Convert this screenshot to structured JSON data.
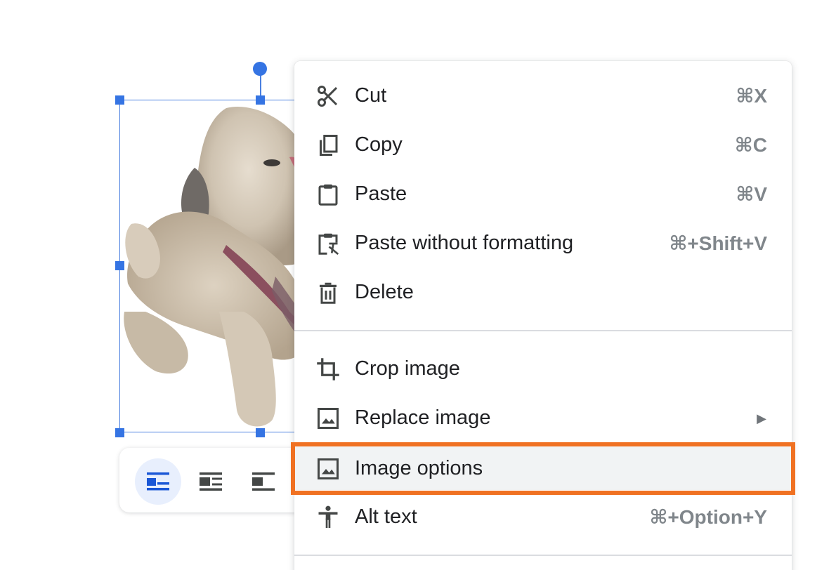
{
  "menu": {
    "items": [
      {
        "label": "Cut",
        "shortcut": "⌘X",
        "icon": "scissors-icon"
      },
      {
        "label": "Copy",
        "shortcut": "⌘C",
        "icon": "copy-icon"
      },
      {
        "label": "Paste",
        "shortcut": "⌘V",
        "icon": "clipboard-icon"
      },
      {
        "label": "Paste without formatting",
        "shortcut": "⌘+Shift+V",
        "icon": "clipboard-clear-format-icon"
      },
      {
        "label": "Delete",
        "shortcut": "",
        "icon": "trash-icon"
      },
      {
        "label": "Crop image",
        "shortcut": "",
        "icon": "crop-icon"
      },
      {
        "label": "Replace image",
        "shortcut": "",
        "icon": "image-icon",
        "submenu_arrow": "▶"
      },
      {
        "label": "Image options",
        "shortcut": "",
        "icon": "image-icon",
        "highlighted": true
      },
      {
        "label": "Alt text",
        "shortcut": "⌘+Option+Y",
        "icon": "accessibility-icon"
      }
    ]
  },
  "wrap_toolbar": {
    "buttons": [
      {
        "icon": "inline-wrap-icon",
        "active": true
      },
      {
        "icon": "wrap-text-icon",
        "active": false
      },
      {
        "icon": "break-text-icon",
        "active": false
      }
    ]
  },
  "colors": {
    "selection": "#3574e3",
    "highlight_frame": "#f07122",
    "menu_text": "#202124",
    "shortcut_text": "#80868b",
    "hover_background": "#f1f3f4"
  }
}
